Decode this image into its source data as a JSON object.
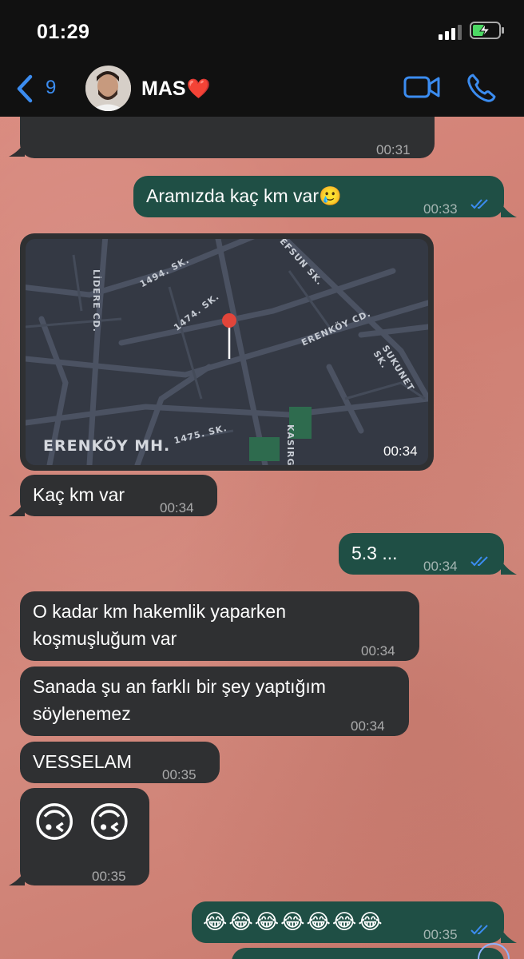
{
  "status_bar": {
    "time": "01:29"
  },
  "header": {
    "back_count": "9",
    "contact_name": "MAS",
    "contact_emoji": "❤️",
    "accent": "#3b8cf0"
  },
  "messages": {
    "m0": {
      "time": "00:31"
    },
    "m1": {
      "text": "Aramızda kaç km var🥲",
      "time": "00:33"
    },
    "map": {
      "area": "ERENKÖY MH.",
      "time": "00:34",
      "streets": {
        "s1": "LİDERE CD.",
        "s2": "1494. SK.",
        "s3": "EFSUN SK.",
        "s4": "1474. SK.",
        "s5": "ERENKÖY CD.",
        "s6": "SUKUNET SK.",
        "s7": "1475. SK.",
        "s8": "KASIRG"
      }
    },
    "m3": {
      "text": "Kaç km var",
      "time": "00:34"
    },
    "m4": {
      "text": "5.3 ...",
      "time": "00:34"
    },
    "m5": {
      "line1": "O kadar km hakemlik yaparken",
      "line2": "koşmuşluğum var",
      "time": "00:34"
    },
    "m6": {
      "line1": "Sanada şu an farklı bir şey yaptığım",
      "line2": "söylenemez",
      "time": "00:34"
    },
    "m7": {
      "text": "VESSELAM",
      "time": "00:35"
    },
    "m8": {
      "emojis": "🙃 🙃",
      "time": "00:35"
    },
    "m9": {
      "emojis": "😂😂😂😂😂😂😂",
      "time": "00:35"
    }
  },
  "colors": {
    "incoming_bubble": "#2f3032",
    "outgoing_bubble": "#1f4f45",
    "read_check": "#3b8cf0"
  }
}
